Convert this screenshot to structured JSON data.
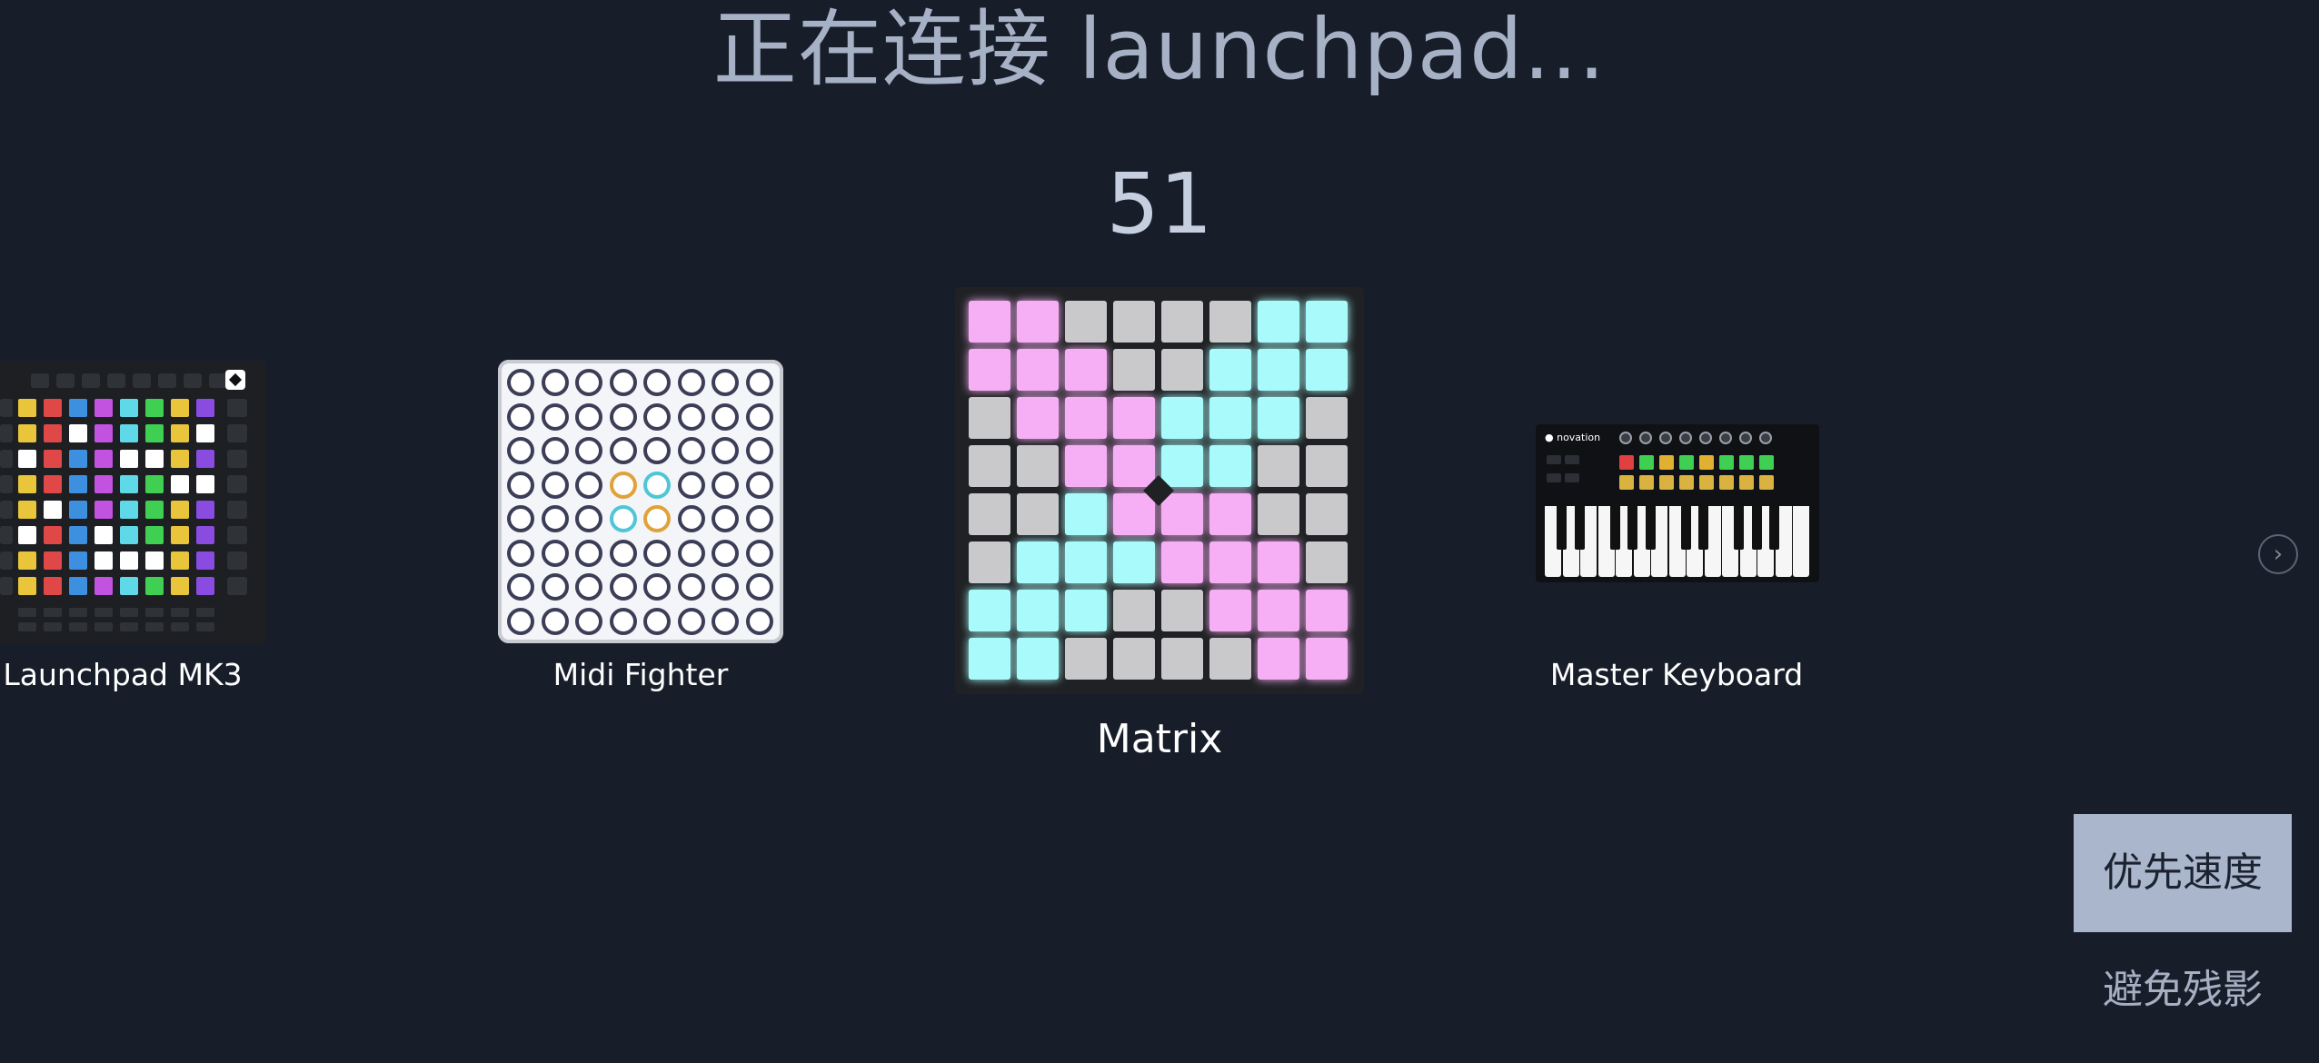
{
  "header": {
    "title": "正在连接 launchpad...",
    "counter": "51"
  },
  "devices": [
    {
      "label": "Launchpad MK3"
    },
    {
      "label": "Midi Fighter"
    },
    {
      "label": "Matrix",
      "selected": true
    },
    {
      "label": "Master Keyboard"
    }
  ],
  "controls": {
    "next_icon": "chevron-right-icon",
    "options": [
      {
        "label": "优先速度",
        "active": true
      },
      {
        "label": "避免残影",
        "active": false
      }
    ]
  },
  "colors": {
    "background": "#171e2a",
    "title": "#a7b1c6",
    "active_option_bg": "#aab6cc",
    "matrix_pink": "#f6aef4",
    "matrix_cyan": "#a8fbfa",
    "matrix_gray": "#c9c9cb"
  }
}
